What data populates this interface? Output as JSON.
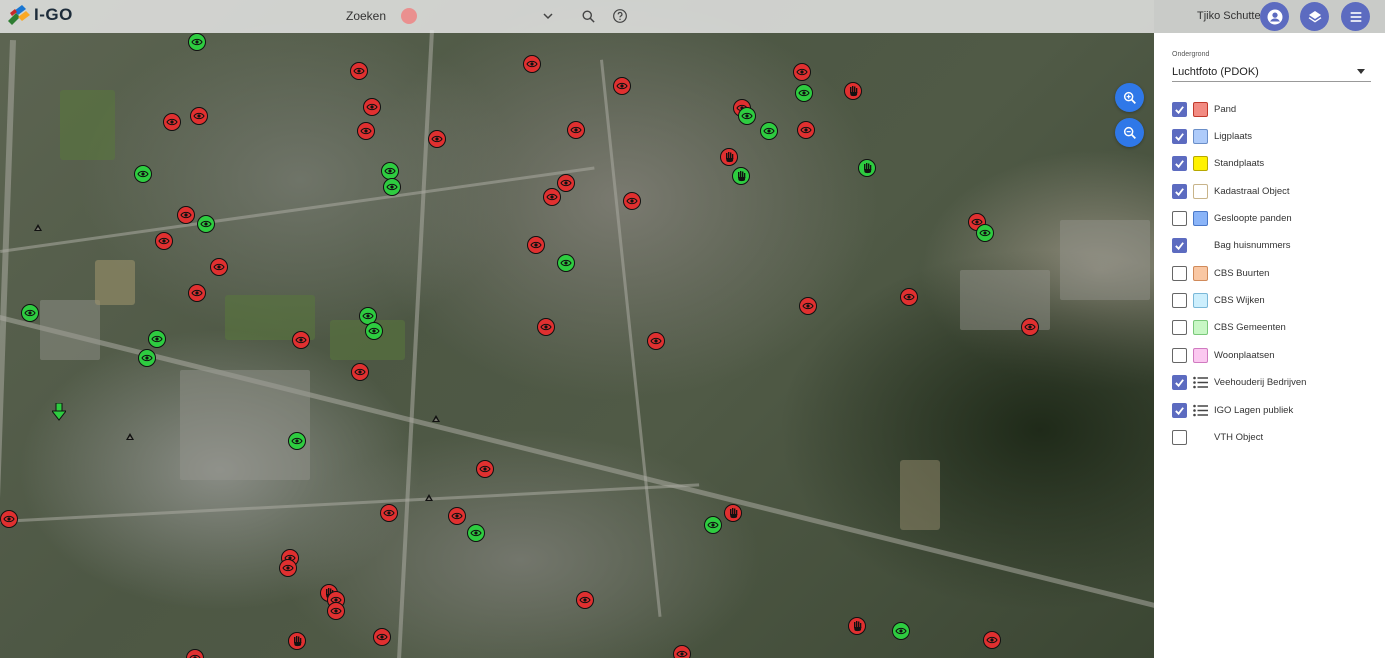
{
  "app": {
    "name": "I-GO"
  },
  "search": {
    "placeholder": "Zoeken"
  },
  "user": {
    "name": "Tjiko Schutte"
  },
  "panel": {
    "basemap_label": "Ondergrond",
    "basemap_value": "Luchtfoto (PDOK)",
    "layers": [
      {
        "label": "Pand",
        "checked": true,
        "swatch_fill": "#f28b82",
        "swatch_border": "#c0392b",
        "kind": "swatch"
      },
      {
        "label": "Ligplaats",
        "checked": true,
        "swatch_fill": "#aecbfa",
        "swatch_border": "#6a8ec8",
        "kind": "swatch"
      },
      {
        "label": "Standplaats",
        "checked": true,
        "swatch_fill": "#fff200",
        "swatch_border": "#b7a800",
        "kind": "swatch"
      },
      {
        "label": "Kadastraal Object",
        "checked": true,
        "swatch_fill": "#ffffff",
        "swatch_border": "#c8b48a",
        "kind": "swatch"
      },
      {
        "label": "Gesloopte panden",
        "checked": false,
        "swatch_fill": "#8ab4f8",
        "swatch_border": "#4a78c8",
        "kind": "swatch"
      },
      {
        "label": "Bag huisnummers",
        "checked": true,
        "kind": "none"
      },
      {
        "label": "CBS Buurten",
        "checked": false,
        "swatch_fill": "#f9c7a3",
        "swatch_border": "#d08a5a",
        "kind": "swatch"
      },
      {
        "label": "CBS Wijken",
        "checked": false,
        "swatch_fill": "#cdeffd",
        "swatch_border": "#7ab8d8",
        "kind": "swatch"
      },
      {
        "label": "CBS Gemeenten",
        "checked": false,
        "swatch_fill": "#c8f7c5",
        "swatch_border": "#7ac87a",
        "kind": "swatch"
      },
      {
        "label": "Woonplaatsen",
        "checked": false,
        "swatch_fill": "#fbc8f0",
        "swatch_border": "#d07ac0",
        "kind": "swatch"
      },
      {
        "label": "Veehouderij Bedrijven",
        "checked": true,
        "kind": "list"
      },
      {
        "label": "IGO Lagen publiek",
        "checked": true,
        "kind": "list"
      },
      {
        "label": "VTH Object",
        "checked": false,
        "kind": "none"
      }
    ]
  },
  "colors": {
    "accent": "#5c6bc0",
    "zoom": "#2f78e8",
    "marker_red": "#e03030",
    "marker_green": "#2ecc40"
  },
  "icons": {
    "search": "search-icon",
    "help": "help-icon",
    "account": "account-icon",
    "layers": "layers-icon",
    "menu": "menu-icon",
    "zoom_in": "zoom-in-icon",
    "zoom_out": "zoom-out-icon"
  }
}
